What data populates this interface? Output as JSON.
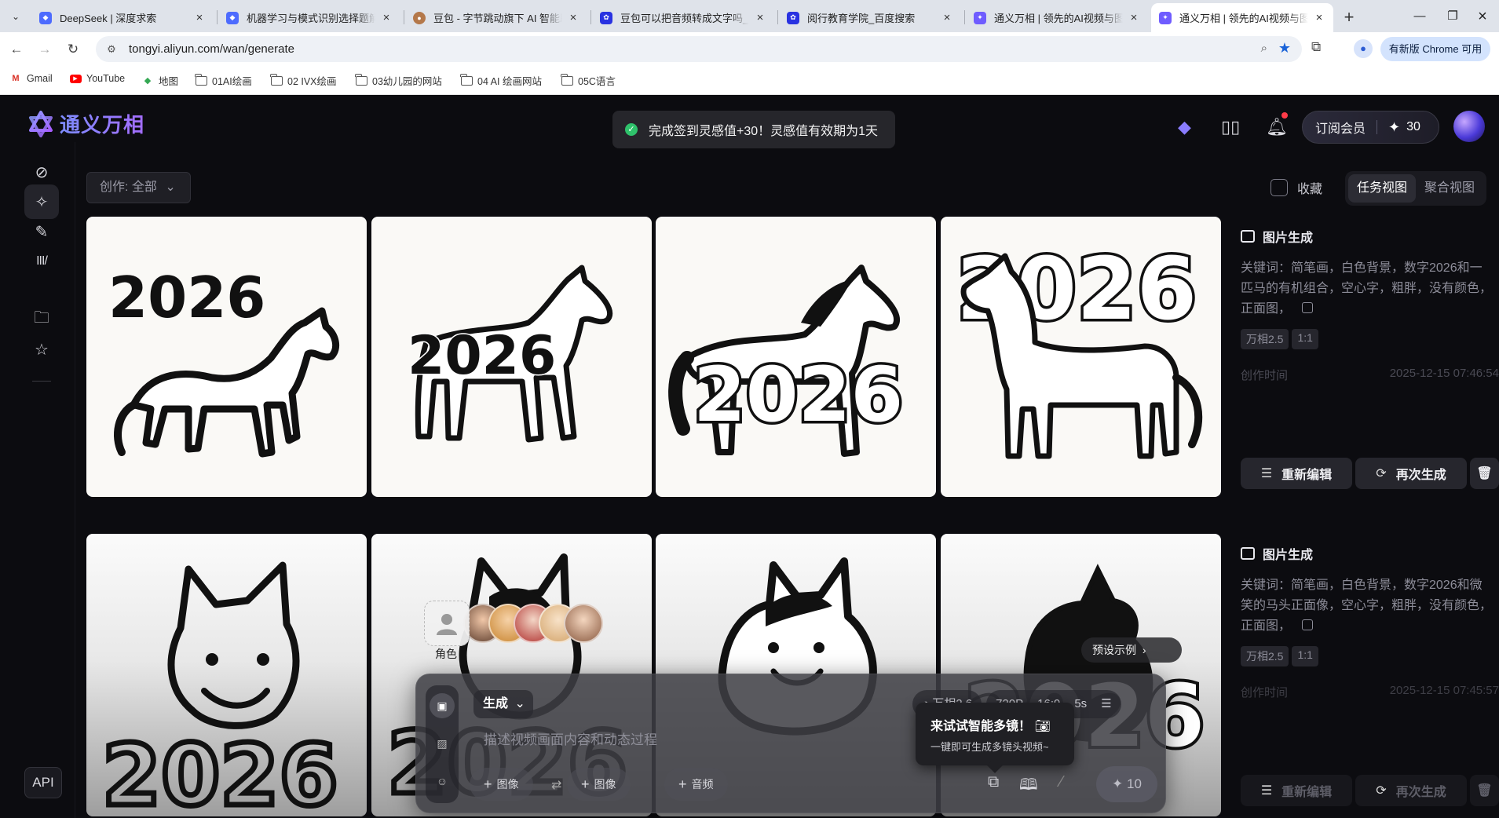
{
  "browser": {
    "tabs": [
      {
        "title": "DeepSeek | 深度求索",
        "fav": "deepseek-favicon",
        "color": "#4d6bfe"
      },
      {
        "title": "机器学习与模式识别选择题解析",
        "fav": "deepseek-favicon",
        "color": "#4d6bfe"
      },
      {
        "title": "豆包 - 字节跳动旗下 AI 智能助手",
        "fav": "doubao-favicon",
        "color": "#b4784a"
      },
      {
        "title": "豆包可以把音频转成文字吗_百度",
        "fav": "baidu-favicon",
        "color": "#2932e1"
      },
      {
        "title": "阅行教育学院_百度搜索",
        "fav": "baidu-favicon",
        "color": "#2932e1"
      },
      {
        "title": "通义万相 | 领先的AI视频与图像",
        "fav": "tongyi-favicon",
        "color": "#6f5cff"
      },
      {
        "title": "通义万相 | 领先的AI视频与图像",
        "fav": "tongyi-favicon",
        "color": "#6f5cff",
        "active": true
      }
    ],
    "url": "tongyi.aliyun.com/wan/generate",
    "update_label": "有新版 Chrome 可用",
    "bookmarks": [
      {
        "label": "Gmail",
        "icon": "gmail-icon"
      },
      {
        "label": "YouTube",
        "icon": "youtube-icon"
      },
      {
        "label": "地图",
        "icon": "maps-icon"
      },
      {
        "label": "01AI绘画",
        "icon": "folder-icon"
      },
      {
        "label": "02 IVX绘画",
        "icon": "folder-icon"
      },
      {
        "label": "03幼儿园的网站",
        "icon": "folder-icon"
      },
      {
        "label": "04 AI 绘画网站",
        "icon": "folder-icon"
      },
      {
        "label": "05C语言",
        "icon": "folder-icon"
      }
    ]
  },
  "app": {
    "brand": "通义万相",
    "toast": "完成签到灵感值+30！灵感值有效期为1天",
    "subscribe_label": "订阅会员",
    "credits": "30",
    "filter_label": "创作: 全部",
    "favorites_label": "收藏",
    "view_tabs": [
      "任务视图",
      "聚合视图"
    ],
    "brand_color": "#7d8cff"
  },
  "tasks": [
    {
      "type": "图片生成",
      "keywords": "关键词：简笔画，白色背景，数字2026和一匹马的有机组合，空心字，粗胖，没有颜色，正面图，",
      "tags": [
        "万相2.5",
        "1:1"
      ],
      "time_label": "创作时间",
      "time": "2025-12-15 07:46:54",
      "edit_label": "重新编辑",
      "regen_label": "再次生成"
    },
    {
      "type": "图片生成",
      "keywords": "关键词：简笔画，白色背景，数字2026和微笑的马头正面像，空心字，粗胖，没有颜色，正面图，",
      "tags": [
        "万相2.5",
        "1:1"
      ],
      "time_label": "创作时间",
      "time": "2025-12-15 07:45:57",
      "edit_label": "重新编辑",
      "regen_label": "再次生成"
    }
  ],
  "images": {
    "caption": "2026"
  },
  "composer": {
    "mode_label": "生成",
    "model": "万相2.6",
    "resolution": "720P",
    "ratio": "16:9",
    "duration": "5s",
    "prompt_placeholder": "描述视频画面内容和动态过程",
    "attach_image_1": "图像",
    "attach_image_2": "图像",
    "attach_audio": "音频",
    "cost": "10",
    "role_label": "角色",
    "preset_label": "预设示例",
    "tip_title": "来试试智能多镜！",
    "tip_sub": "一键即可生成多镜头视频~"
  }
}
